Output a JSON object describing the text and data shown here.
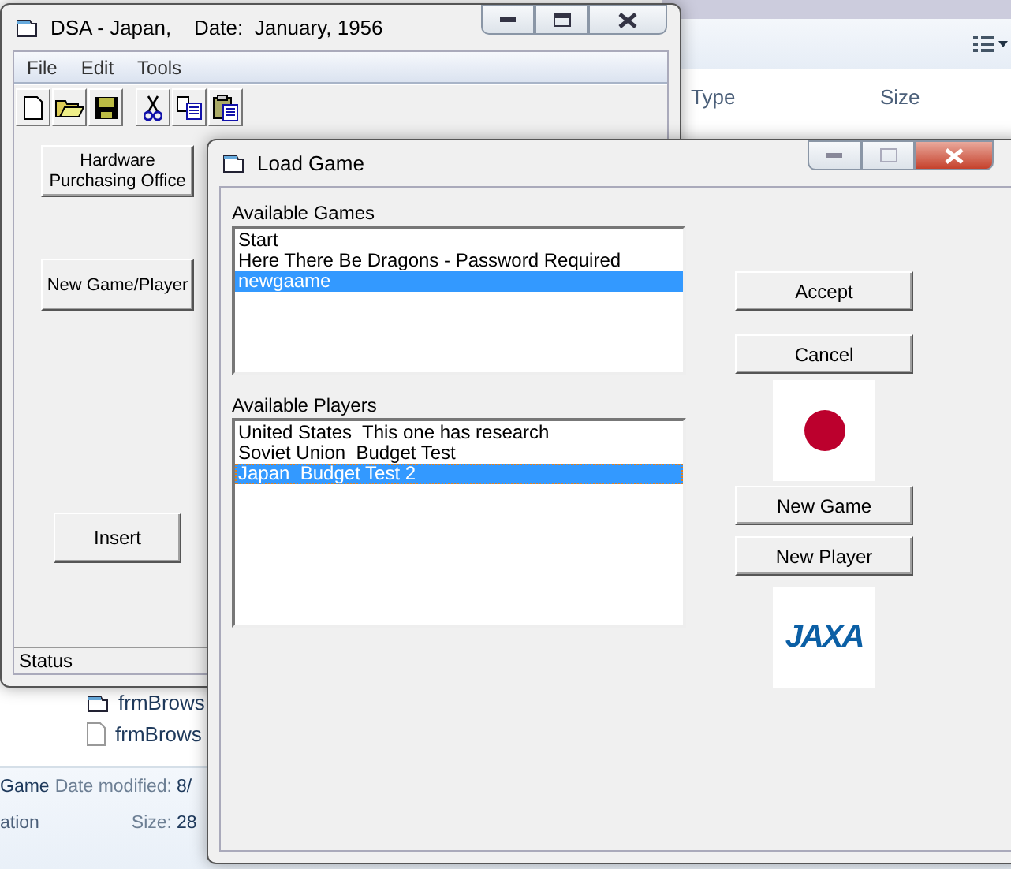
{
  "explorer": {
    "columns": [
      "Type",
      "Size"
    ],
    "files": [
      {
        "name": "frmBrows",
        "kind": "form"
      },
      {
        "name": "frmBrows",
        "kind": "file"
      }
    ],
    "details": {
      "name": "Game",
      "type": "ation",
      "date_label": "Date modified:",
      "date": "8/",
      "size_label": "Size:",
      "size": "28"
    }
  },
  "main_window": {
    "title": "DSA - Japan,    Date:  January, 1956",
    "menu": [
      "File",
      "Edit",
      "Tools"
    ],
    "toolbar": [
      {
        "kind": "new"
      },
      {
        "kind": "open"
      },
      {
        "kind": "save"
      },
      {
        "kind": "cut"
      },
      {
        "kind": "copy"
      },
      {
        "kind": "paste"
      }
    ],
    "buttons": [
      "Hardware Purchasing Office",
      "New Game/Player",
      "Insert"
    ],
    "status": "Status"
  },
  "dialog": {
    "title": "Load Game",
    "games_label": "Available Games",
    "games": [
      {
        "name": "Start",
        "selected": false
      },
      {
        "name": "Here There Be Dragons - Password Required",
        "selected": false
      },
      {
        "name": "newgaame",
        "selected": true
      }
    ],
    "players_label": "Available Players",
    "players": [
      {
        "name": "United States  This one has research",
        "selected": false
      },
      {
        "name": "Soviet Union  Budget Test",
        "selected": false
      },
      {
        "name": "Japan  Budget Test 2",
        "selected": true
      }
    ],
    "buttons": [
      "Accept",
      "Cancel",
      "New Game",
      "New Player"
    ],
    "logo_text": "JAXA"
  }
}
